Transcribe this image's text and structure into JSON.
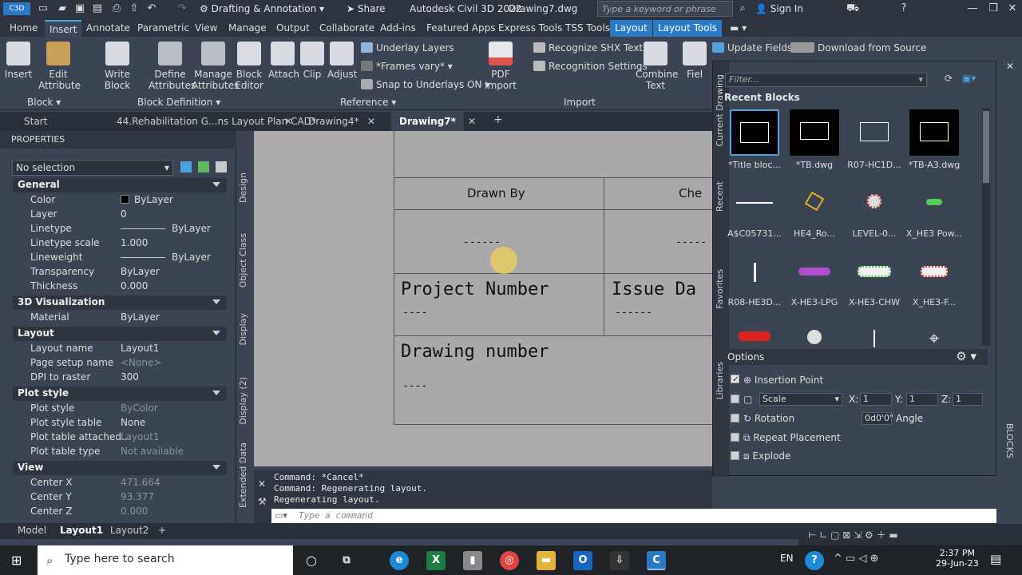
{
  "title_bar": {
    "app_logo": "C3D",
    "workspace": "Drafting & Annotation",
    "share": "Share",
    "app_title": "Autodesk Civil 3D 2022",
    "doc_title": "Drawing7.dwg",
    "search_placeholder": "Type a keyword or phrase",
    "sign_in": "Sign In"
  },
  "ribbon_tabs": [
    "Home",
    "Insert",
    "Annotate",
    "Parametric",
    "View",
    "Manage",
    "Output",
    "Collaborate",
    "Add-ins",
    "Featured Apps",
    "Express Tools",
    "TSS Tools",
    "Layout",
    "Layout Tools"
  ],
  "ribbon": {
    "insert": "Insert",
    "edit_attribute": "Edit\nAttribute",
    "write_block": "Write Block",
    "define_attributes": "Define\nAttributes",
    "manage_attributes": "Manage\nAttributes",
    "block_editor": "Block\nEditor",
    "attach": "Attach",
    "clip": "Clip",
    "adjust": "Adjust",
    "underlay_layers": "Underlay Layers",
    "frames_vary": "*Frames vary*",
    "snap_to_underlays": "Snap to Underlays ON",
    "pdf_import": "PDF\nImport",
    "recognize_shx": "Recognize SHX Text",
    "recognition_settings": "Recognition Settings",
    "combine_text": "Combine\nText",
    "fields": "Fiel",
    "update_fields": "Update Fields",
    "download_from_source": "Download from Source",
    "panel_block": "Block",
    "panel_block_definition": "Block Definition",
    "panel_reference": "Reference",
    "panel_import": "Import"
  },
  "doc_tabs": [
    "Start",
    "44.Rehabilitation G...ns Layout Plan CAD*",
    "Drawing4*",
    "Drawing7*"
  ],
  "properties": {
    "header": "PROPERTIES",
    "selection": "No selection",
    "sections": [
      {
        "name": "General",
        "rows": [
          [
            "Color",
            "ByLayer"
          ],
          [
            "Layer",
            "0"
          ],
          [
            "Linetype",
            "ByLayer"
          ],
          [
            "Linetype scale",
            "1.000"
          ],
          [
            "Lineweight",
            "ByLayer"
          ],
          [
            "Transparency",
            "ByLayer"
          ],
          [
            "Thickness",
            "0.000"
          ]
        ]
      },
      {
        "name": "3D Visualization",
        "rows": [
          [
            "Material",
            "ByLayer"
          ]
        ]
      },
      {
        "name": "Layout",
        "rows": [
          [
            "Layout name",
            "Layout1"
          ],
          [
            "Page setup name",
            "<None>"
          ],
          [
            "DPI to raster",
            "300"
          ]
        ]
      },
      {
        "name": "Plot style",
        "rows": [
          [
            "Plot style",
            "ByColor"
          ],
          [
            "Plot style table",
            "None"
          ],
          [
            "Plot table attached...",
            "Layout1"
          ],
          [
            "Plot table type",
            "Not available"
          ]
        ]
      },
      {
        "name": "View",
        "rows": [
          [
            "Center X",
            "471.664"
          ],
          [
            "Center Y",
            "93.377"
          ],
          [
            "Center Z",
            "0.000"
          ]
        ]
      }
    ],
    "side_tabs": [
      "Design",
      "Object Class",
      "Display",
      "Display (2)",
      "Extended Data"
    ]
  },
  "drawing": {
    "drawn_by": "Drawn By",
    "checked_by": "Che",
    "drawn_value": "------",
    "checked_value": "-----",
    "project_number": "Project Number",
    "project_value": "----",
    "issue_date": "Issue Da",
    "issue_value": "------",
    "drawing_number": "Drawing number",
    "drawing_value": "----"
  },
  "command": {
    "history": [
      "Command: *Cancel*",
      "Command: Regenerating layout.",
      "Regenerating layout."
    ],
    "placeholder": "Type a command"
  },
  "layout_tabs": [
    "Model",
    "Layout1",
    "Layout2"
  ],
  "blocks": {
    "filter_placeholder": "Filter...",
    "recent_title": "Recent Blocks",
    "side_tabs": [
      "Current Drawing",
      "Recent",
      "Favorites",
      "Libraries"
    ],
    "items": [
      "*Title bloc...",
      "*TB.dwg",
      "R07-HC1D...",
      "*TB-A3.dwg",
      "A$C05731...",
      "HE4_Ro...",
      "LEVEL-0...",
      "X_HE3 Pow...",
      "R08-HE3D...",
      "X-HE3-LPG",
      "X-HE3-CHW",
      "X_HE3-F..."
    ],
    "options_title": "Options",
    "insertion_point": "Insertion Point",
    "scale": "Scale",
    "x_label": "X:",
    "y_label": "Y:",
    "z_label": "Z:",
    "x_val": "1",
    "y_val": "1",
    "z_val": "1",
    "rotation": "Rotation",
    "rotation_val": "0d0'0\"",
    "angle": "Angle",
    "repeat_placement": "Repeat Placement",
    "explode": "Explode",
    "palette_label": "BLOCKS"
  },
  "taskbar": {
    "search_placeholder": "Type here to search",
    "lang": "EN",
    "time": "2:37 PM",
    "date": "29-Jun-23"
  }
}
